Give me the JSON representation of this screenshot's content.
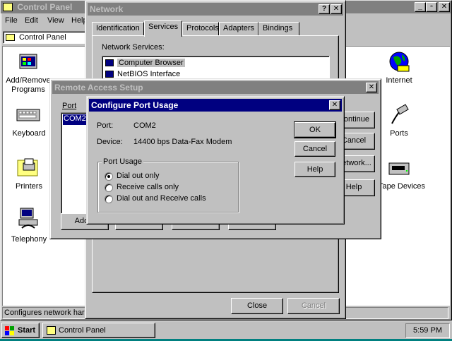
{
  "control_panel": {
    "title": "Control Panel",
    "menu": [
      "File",
      "Edit",
      "View",
      "Help"
    ],
    "address": "Control Panel",
    "status": "Configures network hardware",
    "icons": [
      {
        "label": "Add/Remove Programs",
        "icon": "add-remove-programs-icon"
      },
      {
        "label": "Keyboard",
        "icon": "keyboard-icon"
      },
      {
        "label": "Printers",
        "icon": "printer-folder-icon"
      },
      {
        "label": "Telephony",
        "icon": "telephony-icon"
      },
      {
        "label": "Internet",
        "icon": "internet-globe-icon"
      },
      {
        "label": "Ports",
        "icon": "ports-icon"
      },
      {
        "label": "Tape Devices",
        "icon": "tape-devices-icon"
      }
    ]
  },
  "network": {
    "title": "Network",
    "tabs": [
      "Identification",
      "Services",
      "Protocols",
      "Adapters",
      "Bindings"
    ],
    "active_tab": "Services",
    "services_label": "Network Services:",
    "services": [
      "Computer Browser",
      "NetBIOS Interface"
    ],
    "close_label": "Close",
    "cancel_label": "Cancel"
  },
  "ras": {
    "title": "Remote Access Setup",
    "port_header": "Port",
    "ports": [
      "COM2"
    ],
    "side_buttons": [
      "Continue",
      "Cancel",
      "Network...",
      "Help"
    ],
    "bottom_buttons": [
      "Add...",
      "",
      "",
      ""
    ]
  },
  "dialog": {
    "title": "Configure Port Usage",
    "port_label": "Port:",
    "port_value": "COM2",
    "device_label": "Device:",
    "device_value": "14400 bps Data-Fax Modem",
    "group_label": "Port Usage",
    "options": [
      "Dial out only",
      "Receive calls only",
      "Dial out and Receive calls"
    ],
    "selected_option": 0,
    "ok_label": "OK",
    "cancel_label": "Cancel",
    "help_label": "Help"
  },
  "taskbar": {
    "start_label": "Start",
    "task_label": "Control Panel",
    "clock": "5:59 PM"
  },
  "colors": {
    "desktop": "#008080",
    "title_active": "#000080",
    "title_inactive": "#808080",
    "face": "#c0c0c0"
  }
}
